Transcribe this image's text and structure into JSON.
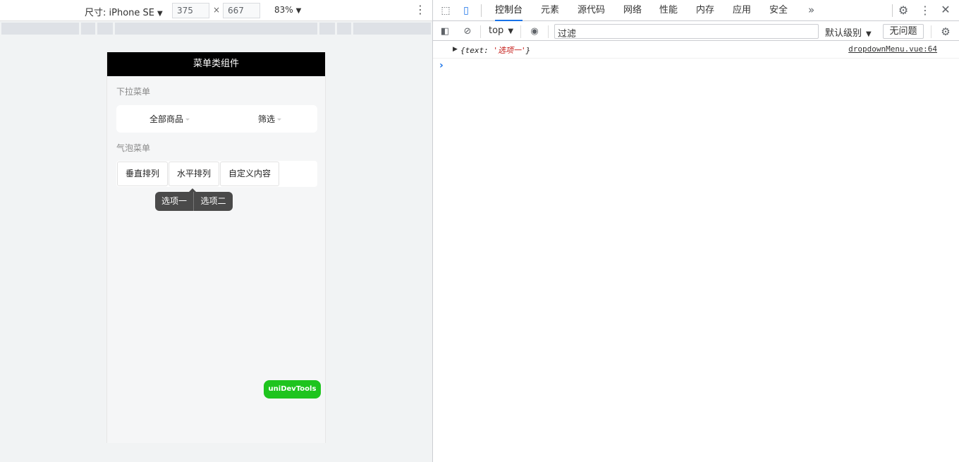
{
  "device_toolbar": {
    "device_label": "尺寸: iPhone SE",
    "width": "375",
    "height": "667",
    "zoom": "83%"
  },
  "phone": {
    "nav_title": "菜单类组件",
    "section_dropdown": "下拉菜单",
    "dropdown_items": [
      "全部商品",
      "筛选"
    ],
    "section_bubble": "气泡菜单",
    "bubble_buttons": [
      "垂直排列",
      "水平排列",
      "自定义内容"
    ],
    "popover_options": [
      "选项一",
      "选项二"
    ],
    "devtools_button": "uniDevTools"
  },
  "devtools": {
    "tabs": [
      "控制台",
      "元素",
      "源代码",
      "网络",
      "性能",
      "内存",
      "应用",
      "安全"
    ],
    "active_tab": "控制台",
    "context": "top",
    "filter_placeholder": "过滤",
    "level": "默认级别",
    "issues_button": "无问题",
    "console": {
      "log_key": "text",
      "log_value": "'选项一'",
      "source": "dropdownMenu.vue:64"
    }
  }
}
